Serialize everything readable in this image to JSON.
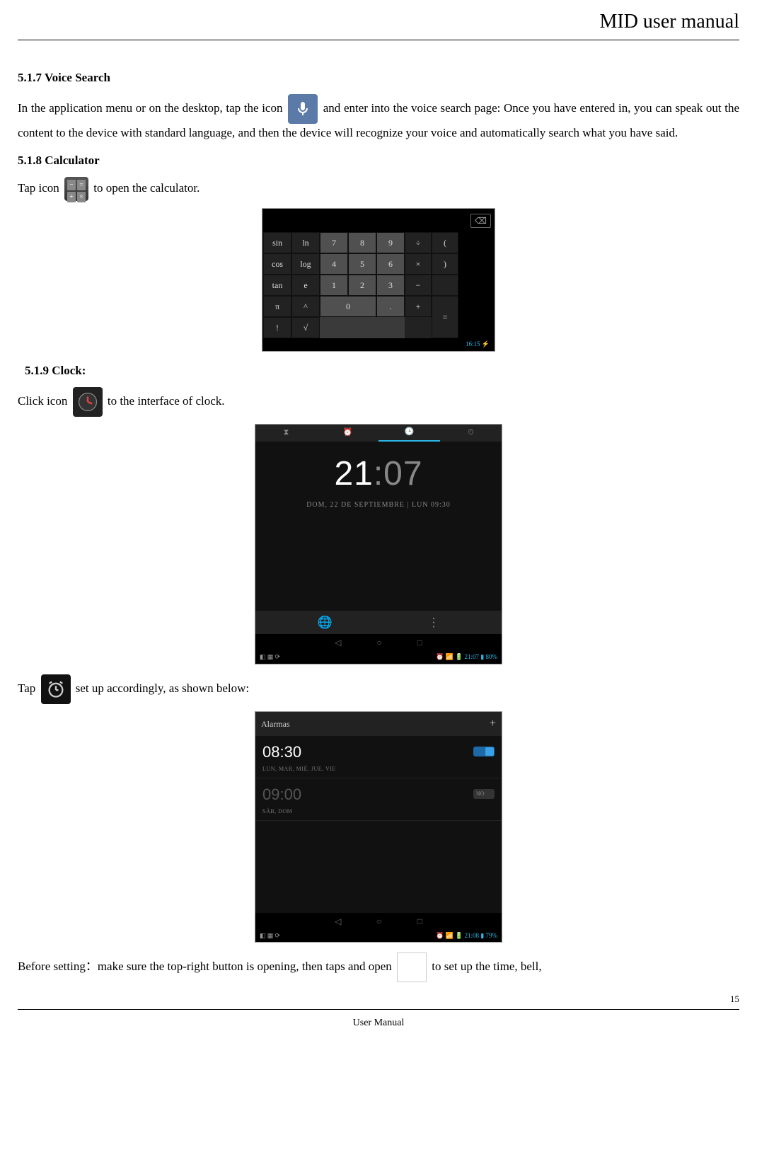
{
  "header": {
    "title": "MID user manual"
  },
  "sections": {
    "voice": {
      "title": "5.1.7 Voice Search",
      "text": "In the application menu or on the desktop, tap the icon and enter into the voice search page: Once you have entered in, you can speak out the content to the device with standard language, and then the device will recognize your voice and automatically search what you have said.",
      "pre": "In the application menu or on the desktop, tap the icon",
      "post": " and enter into the voice search page: Once you have entered in, you can speak out the content to the device with standard language, and then the device will recognize your voice and automatically search what you have said."
    },
    "calc": {
      "title": "5.1.8   Calculator",
      "pre": "Tap icon",
      "post": " to open the calculator."
    },
    "clock": {
      "title": "5.1.9 Clock:",
      "pre": "Click icon ",
      "post": " to the interface of clock.",
      "tap_pre": "Tap ",
      "tap_post": " set up accordingly, as shown below:"
    },
    "before": {
      "pre": "Before setting：make sure the top-right button is opening, then taps and open ",
      "post": " to set up the time, bell,"
    }
  },
  "calc_shot": {
    "sci": [
      "sin",
      "ln",
      "cos",
      "log",
      "tan",
      "e",
      "π",
      "^",
      "!",
      "√"
    ],
    "num": [
      "7",
      "8",
      "9",
      "4",
      "5",
      "6",
      "1",
      "2",
      "3",
      "0",
      "."
    ],
    "ops": [
      "÷",
      "(",
      "×",
      ")",
      "−",
      "",
      "+",
      "="
    ],
    "backspace": "⌫",
    "status": "16:15 ⚡"
  },
  "clock_shot": {
    "tabs_icons": [
      "⧗",
      "⏰",
      "🕒",
      "⏱"
    ],
    "time_h": "21",
    "time_m": ":07",
    "date": "DOM, 22 DE SEPTIEMBRE | LUN 09:30",
    "bottom_icons": [
      "🌐",
      "⋮"
    ],
    "nav": [
      "◁",
      "○",
      "□"
    ],
    "status_left": "◧ ▦ ⟳",
    "status_right": "⏰ 📶 🔋 21:07 ▮ 80%"
  },
  "alarm_shot": {
    "title": "Alarmas",
    "plus": "+",
    "alarms": [
      {
        "time": "08:30",
        "days": "LUN, MAR, MIÉ, JUE, VIE",
        "on": true
      },
      {
        "time": "09:00",
        "days": "SÁB, DOM",
        "on": false
      }
    ],
    "nav": [
      "◁",
      "○",
      "□"
    ],
    "status_left": "◧ ▦ ⟳",
    "status_right": "⏰ 📶 🔋 21:08 ▮ 79%"
  },
  "calc_icon_cells": [
    "−",
    "=",
    "+",
    "×"
  ],
  "page_number": "15",
  "footer": "User Manual"
}
